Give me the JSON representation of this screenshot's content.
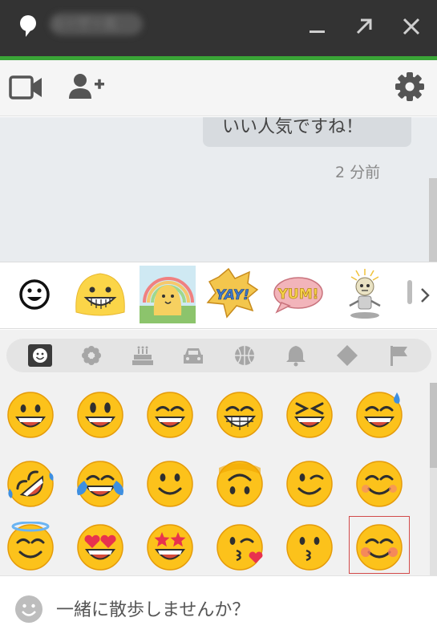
{
  "window": {
    "contact_name": "ユーザー名",
    "accent_color": "#3aa537",
    "titlebar_color": "#333333",
    "icons": [
      "chat-bubble-icon",
      "minimize-icon",
      "popout-icon",
      "close-icon"
    ]
  },
  "toolbar": {
    "icons": [
      "video-call-icon",
      "add-person-icon",
      "gear-icon"
    ]
  },
  "chat": {
    "last_message": "いい人気ですね！",
    "timestamp": "2 分前"
  },
  "stickers": {
    "tabs": [
      "smiley-tab-icon",
      "grinning-blob-sticker",
      "rainbow-blob-sticker",
      "yay-sticker",
      "yum-sticker",
      "robot-sticker"
    ],
    "yay_text": "YAY!",
    "yum_text": "YUM!"
  },
  "emoji_categories": [
    "people",
    "nature",
    "food",
    "travel",
    "activities",
    "objects",
    "symbols",
    "flags"
  ],
  "emoji_grid": {
    "selected_index": 17,
    "items": [
      "grinning-face",
      "grinning-face-big-eyes",
      "grinning-face-smiling-eyes",
      "beaming-face",
      "squinting-face",
      "sweat-smile-face",
      "rolling-laughing-face",
      "tears-of-joy-face",
      "slightly-smiling-face",
      "upside-down-face",
      "winking-face",
      "smiling-eyes-face",
      "halo-face",
      "heart-eyes-face",
      "star-struck-face",
      "kissing-heart-face",
      "kissing-face",
      "blushing-smile-face"
    ]
  },
  "input": {
    "value": "一緒に散歩しませんか？"
  }
}
